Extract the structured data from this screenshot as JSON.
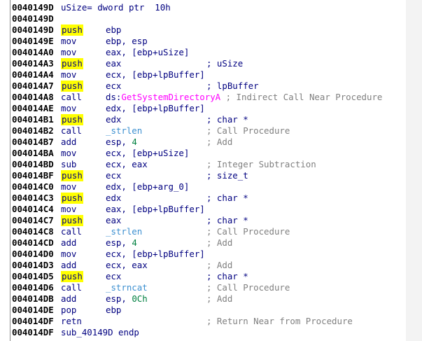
{
  "colors": {
    "address": "#000000",
    "text": "#000080",
    "push_highlight": "#ffff00",
    "comment": "#808080",
    "procedure": "#ff00ff",
    "library": "#3b8fd0",
    "immediate": "#008040"
  },
  "lines": [
    {
      "addr": "0040149D",
      "header": "uSize= dword ptr  10h"
    },
    {
      "addr": "0040149D"
    },
    {
      "addr": "0040149D",
      "mn": "push",
      "ops": "ebp"
    },
    {
      "addr": "0040149E",
      "mn": "mov",
      "ops": "ebp, esp"
    },
    {
      "addr": "004014A0",
      "mn": "mov",
      "ops": "eax, [ebp+uSize]"
    },
    {
      "addr": "004014A3",
      "mn": "push",
      "ops": "eax",
      "cmt": "; uSize",
      "cmt_sym": true
    },
    {
      "addr": "004014A4",
      "mn": "mov",
      "ops": "ecx, [ebp+lpBuffer]"
    },
    {
      "addr": "004014A7",
      "mn": "push",
      "ops": "ecx",
      "cmt": "; lpBuffer",
      "cmt_sym": true
    },
    {
      "addr": "004014A8",
      "mn": "call",
      "ops_prefix": "ds:",
      "ops_proc": "GetSystemDirectoryA",
      "cmt_inline": " ; Indirect Call Near Procedure"
    },
    {
      "addr": "004014AE",
      "mn": "mov",
      "ops": "edx, [ebp+lpBuffer]"
    },
    {
      "addr": "004014B1",
      "mn": "push",
      "ops": "edx",
      "cmt": "; char *",
      "cmt_sym": true
    },
    {
      "addr": "004014B2",
      "mn": "call",
      "ops_lib": "_strlen",
      "cmt": "; Call Procedure"
    },
    {
      "addr": "004014B7",
      "mn": "add",
      "ops": "esp, ",
      "ops_imm": "4",
      "cmt": "; Add"
    },
    {
      "addr": "004014BA",
      "mn": "mov",
      "ops": "ecx, [ebp+uSize]"
    },
    {
      "addr": "004014BD",
      "mn": "sub",
      "ops": "ecx, eax",
      "cmt": "; Integer Subtraction"
    },
    {
      "addr": "004014BF",
      "mn": "push",
      "ops": "ecx",
      "cmt": "; size_t",
      "cmt_sym": true
    },
    {
      "addr": "004014C0",
      "mn": "mov",
      "ops": "edx, [ebp+arg_0]"
    },
    {
      "addr": "004014C3",
      "mn": "push",
      "ops": "edx",
      "cmt": "; char *",
      "cmt_sym": true
    },
    {
      "addr": "004014C4",
      "mn": "mov",
      "ops": "eax, [ebp+lpBuffer]"
    },
    {
      "addr": "004014C7",
      "mn": "push",
      "ops": "eax",
      "cmt": "; char *",
      "cmt_sym": true
    },
    {
      "addr": "004014C8",
      "mn": "call",
      "ops_lib": "_strlen",
      "cmt": "; Call Procedure"
    },
    {
      "addr": "004014CD",
      "mn": "add",
      "ops": "esp, ",
      "ops_imm": "4",
      "cmt": "; Add"
    },
    {
      "addr": "004014D0",
      "mn": "mov",
      "ops": "ecx, [ebp+lpBuffer]"
    },
    {
      "addr": "004014D3",
      "mn": "add",
      "ops": "ecx, eax",
      "cmt": "; Add"
    },
    {
      "addr": "004014D5",
      "mn": "push",
      "ops": "ecx",
      "cmt": "; char *",
      "cmt_sym": true
    },
    {
      "addr": "004014D6",
      "mn": "call",
      "ops_lib": "_strncat",
      "cmt": "; Call Procedure"
    },
    {
      "addr": "004014DB",
      "mn": "add",
      "ops": "esp, ",
      "ops_imm": "0Ch",
      "cmt": "; Add"
    },
    {
      "addr": "004014DE",
      "mn": "pop",
      "ops": "ebp"
    },
    {
      "addr": "004014DF",
      "mn": "retn",
      "cmt": "; Return Near from Procedure"
    },
    {
      "addr": "004014DF",
      "header": "sub_40149D endp"
    }
  ]
}
